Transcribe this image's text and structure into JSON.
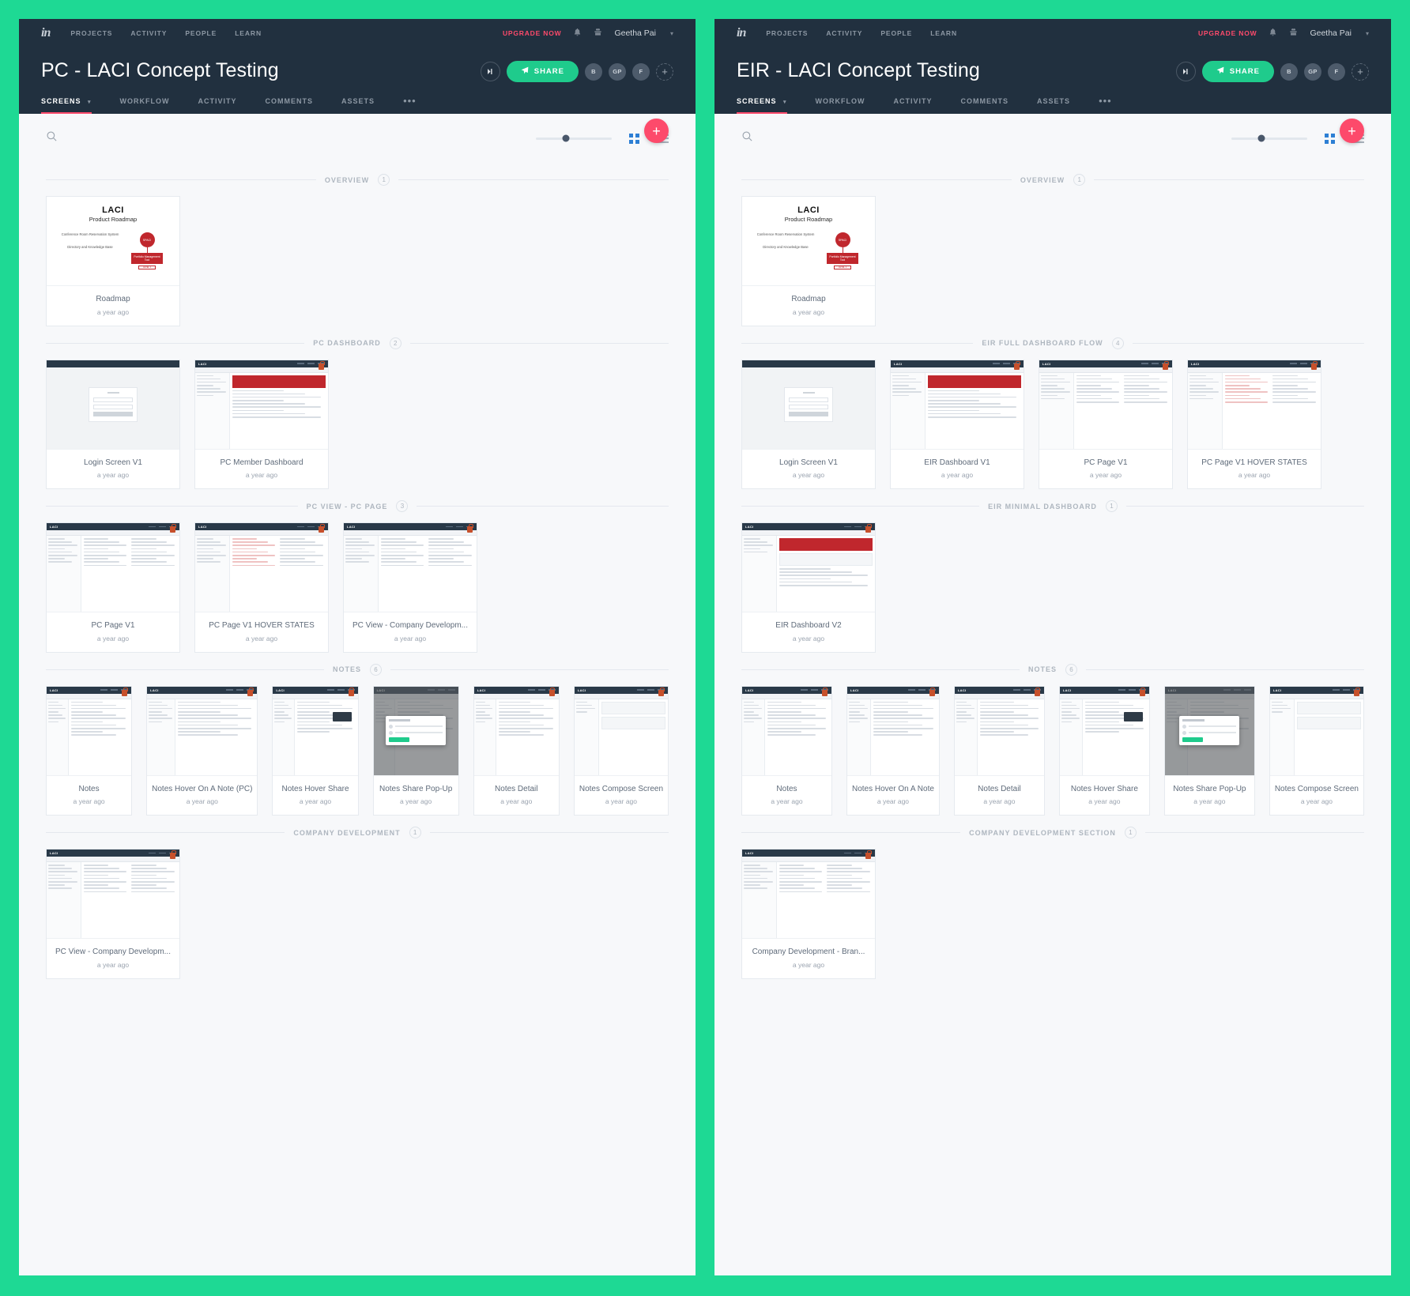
{
  "theme": {
    "page_bg": "#1ed994",
    "header_bg": "#21303f",
    "accent_pink": "#fd4a6b",
    "accent_green": "#1fcb8c",
    "panel_bg": "#f7f8fa"
  },
  "panels": [
    {
      "id": "left",
      "topnav": {
        "logo": "in",
        "links": [
          "PROJECTS",
          "ACTIVITY",
          "PEOPLE",
          "LEARN"
        ],
        "upgrade": "UPGRADE NOW",
        "user": "Geetha Pai",
        "caret": "▾"
      },
      "header": {
        "title": "PC - LACI Concept Testing",
        "share_label": "SHARE",
        "avatars": [
          "B",
          "GP",
          "F"
        ],
        "add_member": "+"
      },
      "tabs": [
        {
          "label": "SCREENS",
          "active": true,
          "caret": "▾"
        },
        {
          "label": "WORKFLOW",
          "active": false
        },
        {
          "label": "ACTIVITY",
          "active": false
        },
        {
          "label": "COMMENTS",
          "active": false
        },
        {
          "label": "ASSETS",
          "active": false
        }
      ],
      "tabs_more": "•••",
      "fab": "+",
      "toolbar": {
        "search_placeholder": "Search",
        "zoom_value": 40,
        "grid_view_active": true
      },
      "sections": [
        {
          "label": "OVERVIEW",
          "count": "1",
          "cards": [
            {
              "title": "Roadmap",
              "date": "a year ago",
              "thumb": "roadmap",
              "locked": false
            }
          ]
        },
        {
          "label": "PC DASHBOARD",
          "count": "2",
          "cards": [
            {
              "title": "Login Screen V1",
              "date": "a year ago",
              "thumb": "login",
              "locked": false
            },
            {
              "title": "PC Member Dashboard",
              "date": "a year ago",
              "thumb": "dashboard-red",
              "locked": true
            }
          ]
        },
        {
          "label": "PC VIEW - PC PAGE",
          "count": "3",
          "cards": [
            {
              "title": "PC Page V1",
              "date": "a year ago",
              "thumb": "page",
              "locked": true
            },
            {
              "title": "PC Page V1 HOVER STATES",
              "date": "a year ago",
              "thumb": "page-hover",
              "locked": true
            },
            {
              "title": "PC View - Company Developm...",
              "date": "a year ago",
              "thumb": "page-dev",
              "locked": true
            }
          ]
        },
        {
          "label": "NOTES",
          "count": "6",
          "cards": [
            {
              "title": "Notes",
              "date": "a year ago",
              "thumb": "notes",
              "locked": true
            },
            {
              "title": "Notes Hover On A Note (PC)",
              "date": "a year ago",
              "thumb": "notes-hover",
              "locked": true
            },
            {
              "title": "Notes Hover Share",
              "date": "a year ago",
              "thumb": "notes-share",
              "locked": true
            },
            {
              "title": "Notes Share Pop-Up",
              "date": "a year ago",
              "thumb": "notes-popup",
              "locked": false
            },
            {
              "title": "Notes Detail",
              "date": "a year ago",
              "thumb": "notes-detail",
              "locked": true
            },
            {
              "title": "Notes Compose Screen",
              "date": "a year ago",
              "thumb": "notes-compose",
              "locked": true
            }
          ]
        },
        {
          "label": "COMPANY DEVELOPMENT",
          "count": "1",
          "cards": [
            {
              "title": "PC View - Company Developm...",
              "date": "a year ago",
              "thumb": "page-dev",
              "locked": true
            }
          ]
        }
      ]
    },
    {
      "id": "right",
      "topnav": {
        "logo": "in",
        "links": [
          "PROJECTS",
          "ACTIVITY",
          "PEOPLE",
          "LEARN"
        ],
        "upgrade": "UPGRADE NOW",
        "user": "Geetha Pai",
        "caret": "▾"
      },
      "header": {
        "title": "EIR - LACI Concept Testing",
        "share_label": "SHARE",
        "avatars": [
          "B",
          "GP",
          "F"
        ],
        "add_member": "+"
      },
      "tabs": [
        {
          "label": "SCREENS",
          "active": true,
          "caret": "▾"
        },
        {
          "label": "WORKFLOW",
          "active": false
        },
        {
          "label": "ACTIVITY",
          "active": false
        },
        {
          "label": "COMMENTS",
          "active": false
        },
        {
          "label": "ASSETS",
          "active": false
        }
      ],
      "tabs_more": "•••",
      "fab": "+",
      "toolbar": {
        "search_placeholder": "Search",
        "zoom_value": 40,
        "grid_view_active": true
      },
      "sections": [
        {
          "label": "OVERVIEW",
          "count": "1",
          "cards": [
            {
              "title": "Roadmap",
              "date": "a year ago",
              "thumb": "roadmap",
              "locked": false
            }
          ]
        },
        {
          "label": "EIR FULL DASHBOARD FLOW",
          "count": "4",
          "cards": [
            {
              "title": "Login Screen V1",
              "date": "a year ago",
              "thumb": "login",
              "locked": false
            },
            {
              "title": "EIR Dashboard V1",
              "date": "a year ago",
              "thumb": "dashboard-red",
              "locked": true
            },
            {
              "title": "PC Page V1",
              "date": "a year ago",
              "thumb": "page",
              "locked": true
            },
            {
              "title": "PC Page V1 HOVER STATES",
              "date": "a year ago",
              "thumb": "page-hover",
              "locked": true
            }
          ]
        },
        {
          "label": "EIR MINIMAL DASHBOARD",
          "count": "1",
          "cards": [
            {
              "title": "EIR Dashboard V2",
              "date": "a year ago",
              "thumb": "dashboard-min",
              "locked": true
            }
          ]
        },
        {
          "label": "NOTES",
          "count": "6",
          "cards": [
            {
              "title": "Notes",
              "date": "a year ago",
              "thumb": "notes",
              "locked": true
            },
            {
              "title": "Notes Hover On A Note",
              "date": "a year ago",
              "thumb": "notes-hover",
              "locked": true
            },
            {
              "title": "Notes Detail",
              "date": "a year ago",
              "thumb": "notes-detail",
              "locked": true
            },
            {
              "title": "Notes Hover Share",
              "date": "a year ago",
              "thumb": "notes-share",
              "locked": true
            },
            {
              "title": "Notes Share Pop-Up",
              "date": "a year ago",
              "thumb": "notes-popup",
              "locked": false
            },
            {
              "title": "Notes Compose Screen",
              "date": "a year ago",
              "thumb": "notes-compose",
              "locked": true
            }
          ]
        },
        {
          "label": "COMPANY DEVELOPMENT SECTION",
          "count": "1",
          "cards": [
            {
              "title": "Company Development - Bran...",
              "date": "a year ago",
              "thumb": "page-dev",
              "locked": true
            }
          ]
        }
      ]
    }
  ],
  "roadmap_thumb": {
    "logo": "LACI",
    "subtitle": "Product Roadmap",
    "left_items": [
      "Conference Room Reservation System",
      "Directory and Knowledge Base"
    ],
    "circle": "SPACI",
    "box": "Portfolio Management Tool",
    "tag": "LEVEL 1"
  }
}
